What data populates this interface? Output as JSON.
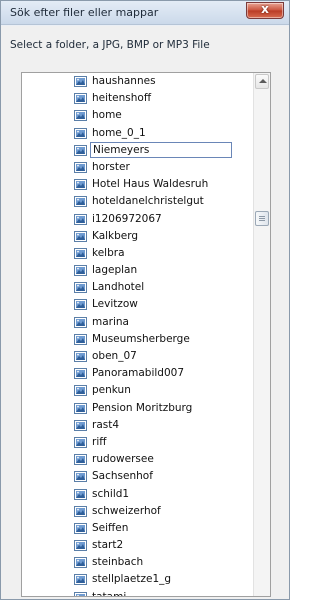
{
  "window": {
    "title": "Sök efter filer eller mappar",
    "close_glyph": "x"
  },
  "dialog": {
    "instruction": "Select a folder, a JPG, BMP or MP3 File"
  },
  "tree": {
    "items": [
      {
        "label": "haushannes",
        "editing": false
      },
      {
        "label": "heitenshoff",
        "editing": false
      },
      {
        "label": "home",
        "editing": false
      },
      {
        "label": "home_0_1",
        "editing": false
      },
      {
        "label": "Niemeyers",
        "editing": true
      },
      {
        "label": "horster",
        "editing": false
      },
      {
        "label": "Hotel Haus Waldesruh",
        "editing": false
      },
      {
        "label": "hoteldanelchristelgut",
        "editing": false
      },
      {
        "label": "i1206972067",
        "editing": false
      },
      {
        "label": "Kalkberg",
        "editing": false
      },
      {
        "label": "kelbra",
        "editing": false
      },
      {
        "label": "lageplan",
        "editing": false
      },
      {
        "label": "Landhotel",
        "editing": false
      },
      {
        "label": "Levitzow",
        "editing": false
      },
      {
        "label": "marina",
        "editing": false
      },
      {
        "label": "Museumsherberge",
        "editing": false
      },
      {
        "label": "oben_07",
        "editing": false
      },
      {
        "label": "Panoramabild007",
        "editing": false
      },
      {
        "label": "penkun",
        "editing": false
      },
      {
        "label": "Pension Moritzburg",
        "editing": false
      },
      {
        "label": "rast4",
        "editing": false
      },
      {
        "label": "riff",
        "editing": false
      },
      {
        "label": "rudowersee",
        "editing": false
      },
      {
        "label": "Sachsenhof",
        "editing": false
      },
      {
        "label": "schild1",
        "editing": false
      },
      {
        "label": "schweizerhof",
        "editing": false
      },
      {
        "label": "Seiffen",
        "editing": false
      },
      {
        "label": "start2",
        "editing": false
      },
      {
        "label": "steinbach",
        "editing": false
      },
      {
        "label": "stellplaetze1_g",
        "editing": false
      },
      {
        "label": "tatami",
        "editing": false
      }
    ],
    "icon": "image-file-icon"
  }
}
